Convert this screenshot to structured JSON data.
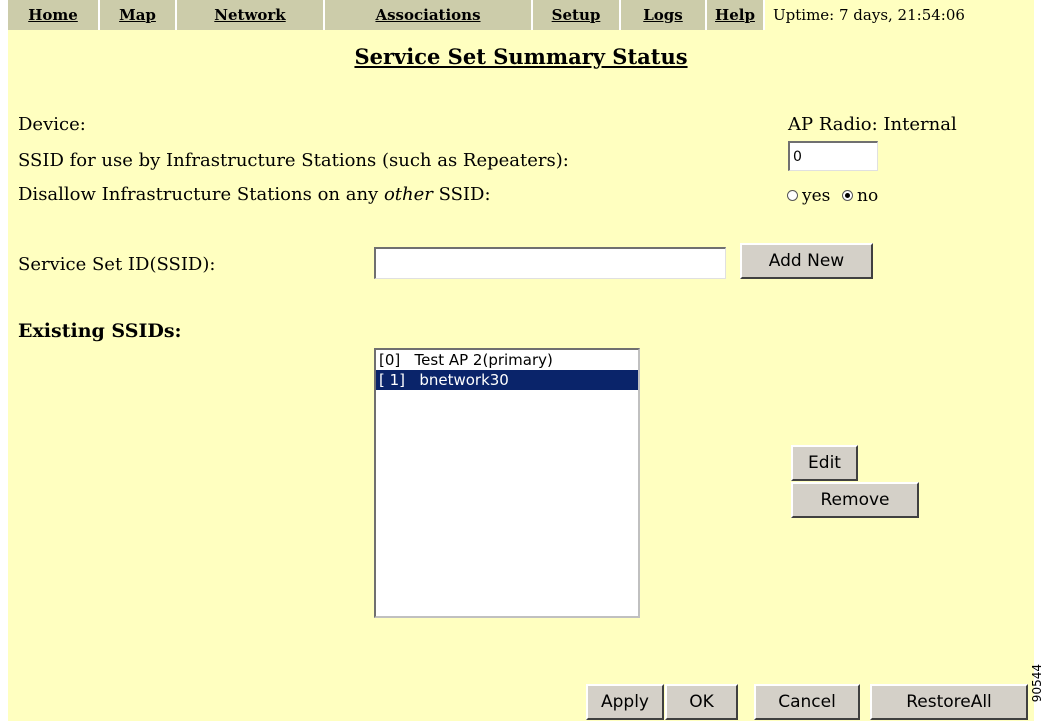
{
  "nav": {
    "items": [
      "Home",
      "Map",
      "Network",
      "Associations",
      "Setup",
      "Logs",
      "Help"
    ],
    "uptime": "Uptime: 7 days, 21:54:06"
  },
  "page_title": "Service Set Summary Status",
  "device": {
    "label": "Device:",
    "value": "AP Radio: Internal"
  },
  "infra_ssid": {
    "label": "SSID for use by Infrastructure Stations (such as Repeaters):",
    "value": "0"
  },
  "disallow": {
    "label_before": "Disallow Infrastructure Stations on any ",
    "label_em": "other",
    "label_after": " SSID:",
    "yes_label": "yes",
    "no_label": "no",
    "selected": "no"
  },
  "ssid_entry": {
    "label": "Service Set ID(SSID):",
    "value": "",
    "add_button": "Add New"
  },
  "existing": {
    "heading": "Existing SSIDs:",
    "options": [
      {
        "text": "[0]   Test AP 2(primary)",
        "selected": false
      },
      {
        "text": "[ 1]   bnetwork30",
        "selected": true
      }
    ],
    "edit_button": "Edit",
    "remove_button": "Remove"
  },
  "footer": {
    "apply": "Apply",
    "ok": "OK",
    "cancel": "Cancel",
    "restore_all": "RestoreAll"
  },
  "figure_id": "90544"
}
